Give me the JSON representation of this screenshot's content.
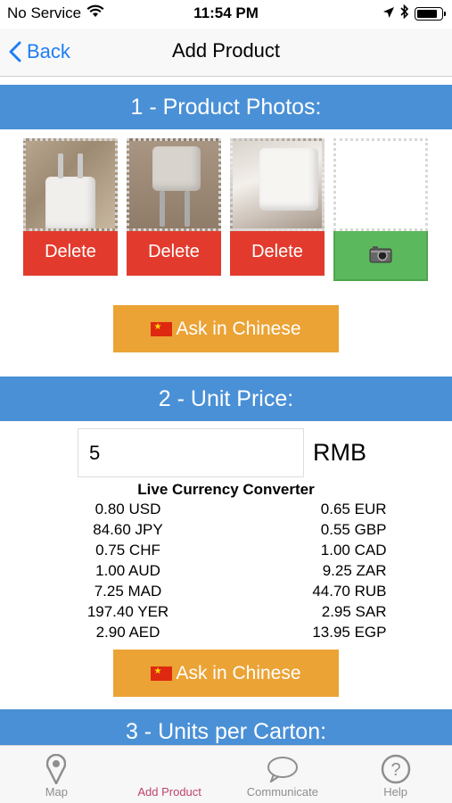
{
  "status_bar": {
    "carrier": "No Service",
    "time": "11:54 PM",
    "battery_level": 0.85
  },
  "nav": {
    "back_label": "Back",
    "title": "Add Product"
  },
  "sections": {
    "photos_title": "1 - Product Photos:",
    "price_title": "2 - Unit Price:",
    "carton_title": "3 - Units per Carton:"
  },
  "photos": {
    "delete_label": "Delete",
    "camera_icon": "camera-icon"
  },
  "ask_button_label": "Ask in Chinese",
  "price": {
    "value": "5",
    "currency": "RMB"
  },
  "converter": {
    "title": "Live Currency Converter",
    "rows": [
      {
        "left": "0.80 USD",
        "right": "0.65 EUR"
      },
      {
        "left": "84.60 JPY",
        "right": "0.55 GBP"
      },
      {
        "left": "0.75 CHF",
        "right": "1.00 CAD"
      },
      {
        "left": "1.00 AUD",
        "right": "9.25 ZAR"
      },
      {
        "left": "7.25 MAD",
        "right": "44.70 RUB"
      },
      {
        "left": "197.40 YER",
        "right": "2.95 SAR"
      },
      {
        "left": "2.90 AED",
        "right": "13.95 EGP"
      }
    ]
  },
  "tabs": [
    {
      "label": "Map",
      "icon": "map-pin-icon"
    },
    {
      "label": "Add Product",
      "icon": "add-product-icon"
    },
    {
      "label": "Communicate",
      "icon": "chat-bubble-icon"
    },
    {
      "label": "Help",
      "icon": "help-icon"
    }
  ],
  "colors": {
    "section_header": "#4a90d6",
    "delete": "#e23b2e",
    "camera": "#5cb85c",
    "ask": "#eba335",
    "tab_active": "#c0446b",
    "link": "#1f7ef5"
  }
}
